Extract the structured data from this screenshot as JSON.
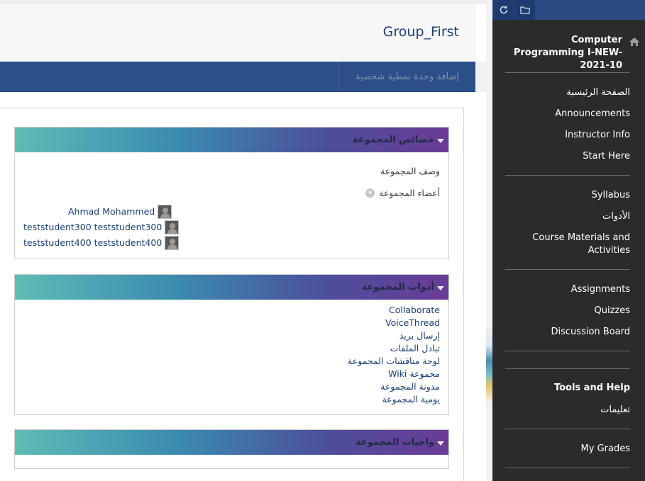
{
  "page": {
    "title": "Group_First",
    "add_module_button": "إضافة وحدة نمطية شخصية"
  },
  "group_properties": {
    "title": "خصائص المجموعة",
    "description_label": "وصف المجموعة",
    "members_label": "أعضاء المجموعة",
    "members": [
      {
        "name": "Ahmad Mohammed"
      },
      {
        "name": "teststudent300 teststudent300"
      },
      {
        "name": "teststudent400 teststudent400"
      }
    ]
  },
  "group_tools": {
    "title": "أدوات المجموعة",
    "items": [
      "Collaborate",
      "VoiceThread",
      "إرسال بريد",
      "تبادل الملفات",
      "لوحة مناقشات المجموعة",
      "مجموعة Wiki",
      "مدونة المجموعة",
      "يومية المجموعة"
    ]
  },
  "group_assignments": {
    "title": "واجبات المجموعة"
  },
  "sidebar": {
    "course_title": "Computer Programming I-NEW-2021-10",
    "section1": [
      "الصفحة الرئيسية",
      "Announcements",
      "Instructor Info",
      "Start Here"
    ],
    "section2": [
      "Syllabus",
      "الأدوات",
      "Course Materials and Activities"
    ],
    "section3": [
      "Assignments",
      "Quizzes",
      "Discussion Board"
    ],
    "tools_heading": "Tools and Help",
    "tools_item": "تعليمات",
    "grades": "My Grades"
  },
  "colors": {
    "sidebar_bg": "#2b2b2b",
    "nav_bar": "#2b4f86",
    "link": "#173e7a",
    "header_gradient": [
      "#5ebcb4",
      "#3b8ab0",
      "#4d4e9a",
      "#6a3c96"
    ]
  },
  "icons": [
    "refresh-icon",
    "folder-icon",
    "home-icon",
    "chevron-down-icon",
    "avatar"
  ]
}
